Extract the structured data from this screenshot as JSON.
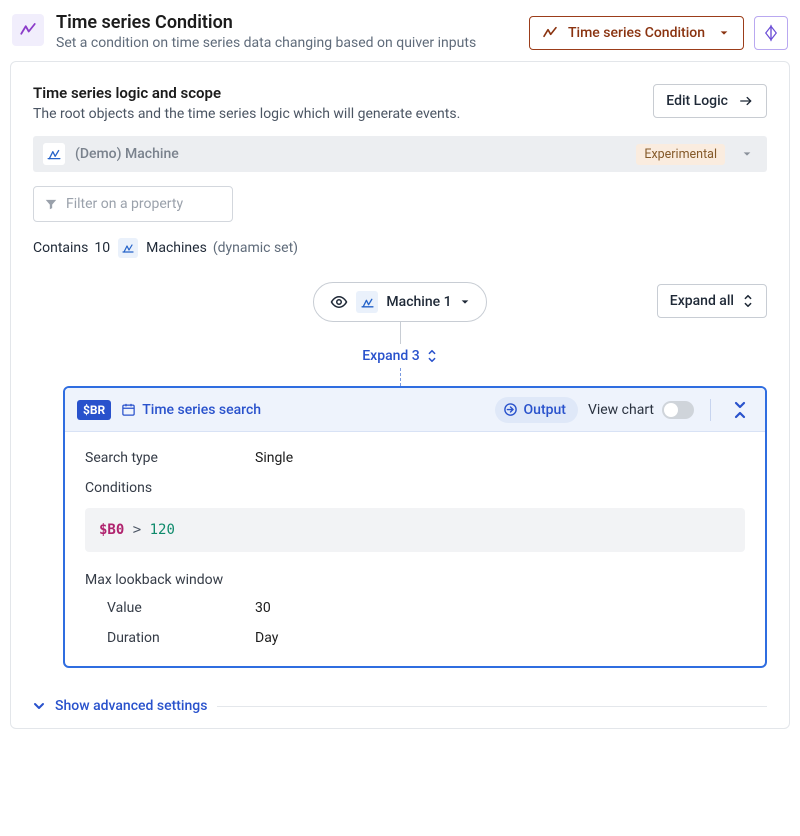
{
  "header": {
    "title": "Time series Condition",
    "subtitle": "Set a condition on time series data changing based on quiver inputs",
    "dropdown_label": "Time series Condition"
  },
  "scope": {
    "section_title": "Time series logic and scope",
    "section_desc": "The root objects and the time series logic which will generate events.",
    "edit_button": "Edit Logic",
    "object_name": "(Demo) Machine",
    "object_badge": "Experimental",
    "filter_placeholder": "Filter on a property",
    "contains_prefix": "Contains",
    "contains_count": "10",
    "contains_type": "Machines",
    "contains_suffix": "(dynamic set)"
  },
  "tree": {
    "node_label": "Machine 1",
    "expand_all": "Expand all",
    "expand_n": "Expand 3"
  },
  "panel": {
    "var_badge": "$BR",
    "title": "Time series search",
    "output_label": "Output",
    "view_chart": "View chart",
    "search_type_label": "Search type",
    "search_type_value": "Single",
    "conditions_label": "Conditions",
    "condition_var": "$B0",
    "condition_op": ">",
    "condition_num": "120",
    "lookback_label": "Max lookback window",
    "lookback_value_label": "Value",
    "lookback_value": "30",
    "lookback_duration_label": "Duration",
    "lookback_duration": "Day"
  },
  "advanced": {
    "label": "Show advanced settings"
  }
}
